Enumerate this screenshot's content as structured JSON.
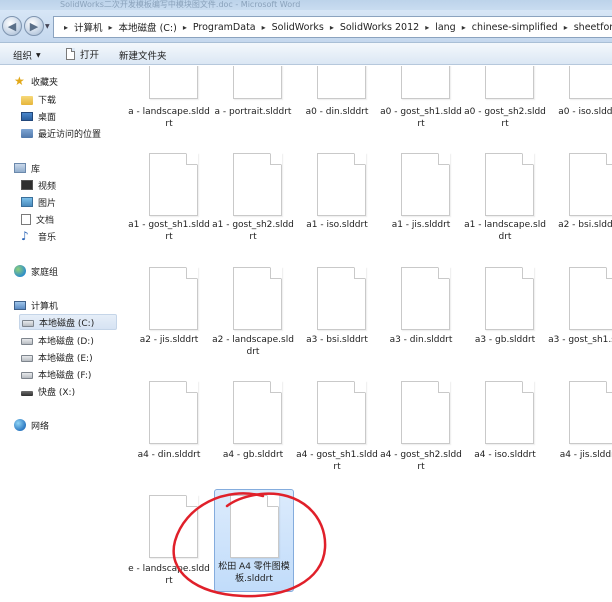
{
  "window": {
    "title": "SolidWorks二次开发模板编写中模块图文件.doc - Microsoft Word"
  },
  "address": {
    "crumbs": [
      "计算机",
      "本地磁盘 (C:)",
      "ProgramData",
      "SolidWorks",
      "SolidWorks 2012",
      "lang",
      "chinese-simplified",
      "sheetform"
    ],
    "separator": "▸"
  },
  "toolbar": {
    "organize_label": "组织",
    "open_label": "打开",
    "new_folder_label": "新建文件夹"
  },
  "nav": {
    "favorites": "收藏夹",
    "downloads": "下载",
    "desktop": "桌面",
    "recent": "最近访问的位置",
    "libraries": "库",
    "videos": "视频",
    "pictures": "图片",
    "documents": "文档",
    "music": "音乐",
    "homegroup": "家庭组",
    "computer": "计算机",
    "drive_c": "本地磁盘 (C:)",
    "drive_d": "本地磁盘 (D:)",
    "drive_e": "本地磁盘 (E:)",
    "drive_f": "本地磁盘 (F:)",
    "usb_x": "快盘 (X:)",
    "network": "网络"
  },
  "files": {
    "row1": [
      "a - landscape.slddrt",
      "a - portrait.slddrt",
      "a0 - din.slddrt",
      "a0 - gost_sh1.slddrt",
      "a0 - gost_sh2.slddrt",
      "a0 - iso.slddrt"
    ],
    "row2": [
      "a1 - gost_sh1.slddrt",
      "a1 - gost_sh2.slddrt",
      "a1 - iso.slddrt",
      "a1 - jis.slddrt",
      "a1 - landscape.slddrt",
      "a2 - bsi.slddrt"
    ],
    "row3": [
      "a2 - jis.slddrt",
      "a2 - landscape.slddrt",
      "a3 - bsi.slddrt",
      "a3 - din.slddrt",
      "a3 - gb.slddrt",
      "a3 - gost_sh1.sldd"
    ],
    "row4": [
      "a4 - din.slddrt",
      "a4 - gb.slddrt",
      "a4 - gost_sh1.slddrt",
      "a4 - gost_sh2.slddrt",
      "a4 - iso.slddrt",
      "a4 - jis.slddrt"
    ],
    "row5": [
      "e - landscape.slddrt",
      "松田 A4 零件图模板.slddrt"
    ]
  },
  "colors": {
    "accent": "#84acdd",
    "selection": "#c1dcfa",
    "annotation": "#e0202a"
  }
}
